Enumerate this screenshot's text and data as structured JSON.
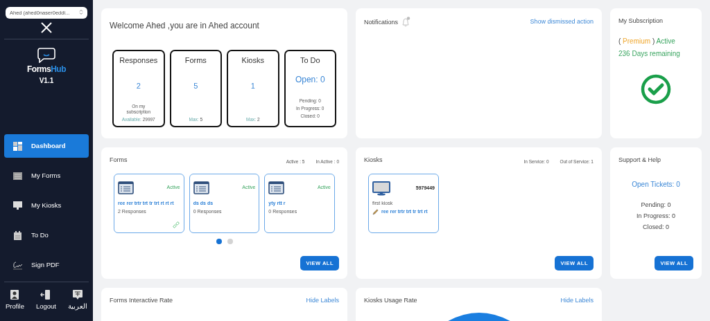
{
  "sidebar": {
    "account_select": {
      "value": "Ahed (ahed0naser0eddi..."
    },
    "logo": {
      "text_a": "Forms",
      "text_b": "Hub",
      "version": "V1.1"
    },
    "items": [
      {
        "label": "Dashboard",
        "kind": "dashboard",
        "selected": true
      },
      {
        "label": "My Forms",
        "kind": "forms",
        "selected": false
      },
      {
        "label": "My Kiosks",
        "kind": "kiosk",
        "selected": false
      },
      {
        "label": "To Do",
        "kind": "calendar",
        "selected": false
      },
      {
        "label": "Sign PDF",
        "kind": "signature",
        "selected": false
      }
    ],
    "footer": [
      {
        "label": "Profile",
        "kind": "profile"
      },
      {
        "label": "Logout",
        "kind": "logout"
      },
      {
        "label": "العربية",
        "kind": "language"
      }
    ]
  },
  "welcome": {
    "title": "Welcome Ahed ,you are in Ahed account",
    "stats": [
      {
        "title": "Responses",
        "value": "2",
        "notes": [
          "On my subscription"
        ],
        "footer_label": "Available:",
        "footer_value": "29997"
      },
      {
        "title": "Forms",
        "value": "5",
        "footer_label": "Max:",
        "footer_value": "5"
      },
      {
        "title": "Kiosks",
        "value": "1",
        "footer_label": "Max:",
        "footer_value": "2"
      },
      {
        "title": "To Do",
        "value": "Open: 0",
        "notes": [
          "Pending: 0",
          "In Progress: 0",
          "Closed: 0"
        ]
      }
    ]
  },
  "notifications": {
    "title": "Notifications",
    "link": "Show dismissed action"
  },
  "subscription": {
    "title": "My Subscription",
    "open": "(",
    "plan": "Premium",
    "close": ")",
    "status": "Active",
    "remaining": "236 Days remaining"
  },
  "forms": {
    "title": "Forms",
    "counts": [
      "Active : 5",
      "In Active : 0"
    ],
    "items": [
      {
        "status": "Active",
        "name": "ree rer trtr trt tr trt rt rt rt",
        "responses": "2 Responses",
        "linked": true
      },
      {
        "status": "Active",
        "name": "ds ds ds",
        "responses": "0 Responses",
        "linked": false
      },
      {
        "status": "Active",
        "name": "yty rtt r",
        "responses": "0 Responses",
        "linked": false
      }
    ],
    "pages": [
      {
        "selected": true
      },
      {
        "selected": false
      }
    ],
    "button": "VIEW ALL"
  },
  "kiosks": {
    "title": "Kiosks",
    "counts": [
      "In Service: 0",
      "Out of Service: 1"
    ],
    "items": [
      {
        "code": "5979449",
        "name": "first kiosk",
        "form": "ree rer trtr trt tr trt rt"
      }
    ],
    "button": "VIEW ALL"
  },
  "support": {
    "title": "Support & Help",
    "open": "Open Tickets: 0",
    "lines": [
      "Pending: 0",
      "In Progress: 0",
      "Closed: 0"
    ],
    "button": "VIEW ALL"
  },
  "forms_rate": {
    "title": "Forms Interactive Rate",
    "link": "Hide Labels"
  },
  "kiosks_rate": {
    "title": "Kiosks Usage Rate",
    "link": "Hide Labels"
  }
}
